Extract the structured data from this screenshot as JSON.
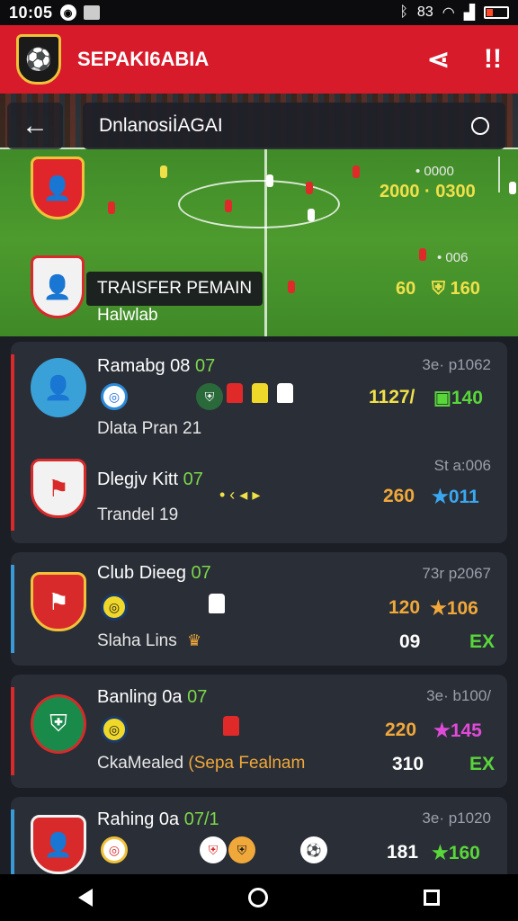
{
  "status": {
    "time": "10:05",
    "right_text": "83"
  },
  "appbar": {
    "title": "SEPAKI6ABIA",
    "share_icon": "share-icon",
    "more_icon": "more-icon"
  },
  "hero": {
    "search_label": "DnlanosiİAGAI",
    "badge": "TRAISFER PEMAIN",
    "subtitle": "Halwlab",
    "score_top": "2000 · 0300",
    "score_top_small": "• 0000",
    "score_bottom_small": "• 006",
    "stat_a": "60",
    "stat_b": "160"
  },
  "cards": [
    {
      "title": "Ramabg 08",
      "year": "07",
      "subtitle": "Dlata Pran 21",
      "meta": "3e· p1062",
      "value": "1127/",
      "score": "140",
      "score_color": "#59d63a",
      "stripe": "#d82a2a"
    },
    {
      "title": "Dlegjv Kitt",
      "year": "07",
      "subtitle": "Trandel 19",
      "meta": "St a:006",
      "value": "260",
      "score": "011",
      "score_color": "#3aa8f0",
      "stripe": "#3a9ad8"
    },
    {
      "title": "Club Dieeg",
      "year": "07",
      "subtitle": "Slaha Lins",
      "meta": "73r p2067",
      "value": "120",
      "score": "106",
      "second_value": "09",
      "second_score": "EX",
      "score_color": "#f0a83a",
      "stripe": "#3a9ad8"
    },
    {
      "title": "Banling 0a",
      "year": "07",
      "subtitle": "CkaMealed",
      "subtitle_extra": "(Sepa Fealnam",
      "meta": "3e· b100/",
      "value": "220",
      "score": "145",
      "second_value": "310",
      "second_score": "EX",
      "score_color": "#e04ad8",
      "stripe": "#d82a2a"
    },
    {
      "title": "Rahing 0a",
      "year": "07/1",
      "meta": "3e· p1020",
      "value": "181",
      "score": "160",
      "score_color": "#59d63a",
      "stripe": "#3a9ad8"
    }
  ]
}
